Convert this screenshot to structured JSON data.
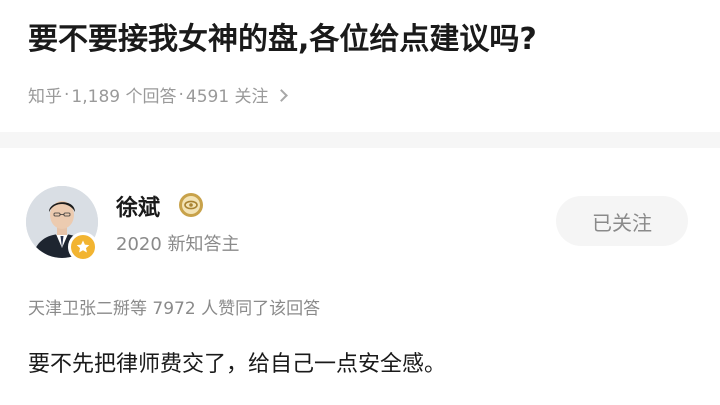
{
  "question": {
    "title": "要不要接我女神的盘,各位给点建议吗?",
    "source": "知乎",
    "answers": "1,189 个回答",
    "followers": "4591 关注"
  },
  "answer": {
    "author_name": "徐斌",
    "author_title": "2020 新知答主",
    "follow_label": "已关注",
    "upvote_line": "天津卫张二掰等 7972 人赞同了该回答",
    "content": "要不先把律师费交了，给自己一点安全感。"
  },
  "icons": {
    "badge": "star-badge-icon",
    "medal": "medal-icon",
    "chevron": "chevron-right-icon"
  },
  "colors": {
    "badge": "#f2b431",
    "medal": "#c8a24a",
    "meta_text": "#9a9a9a"
  }
}
